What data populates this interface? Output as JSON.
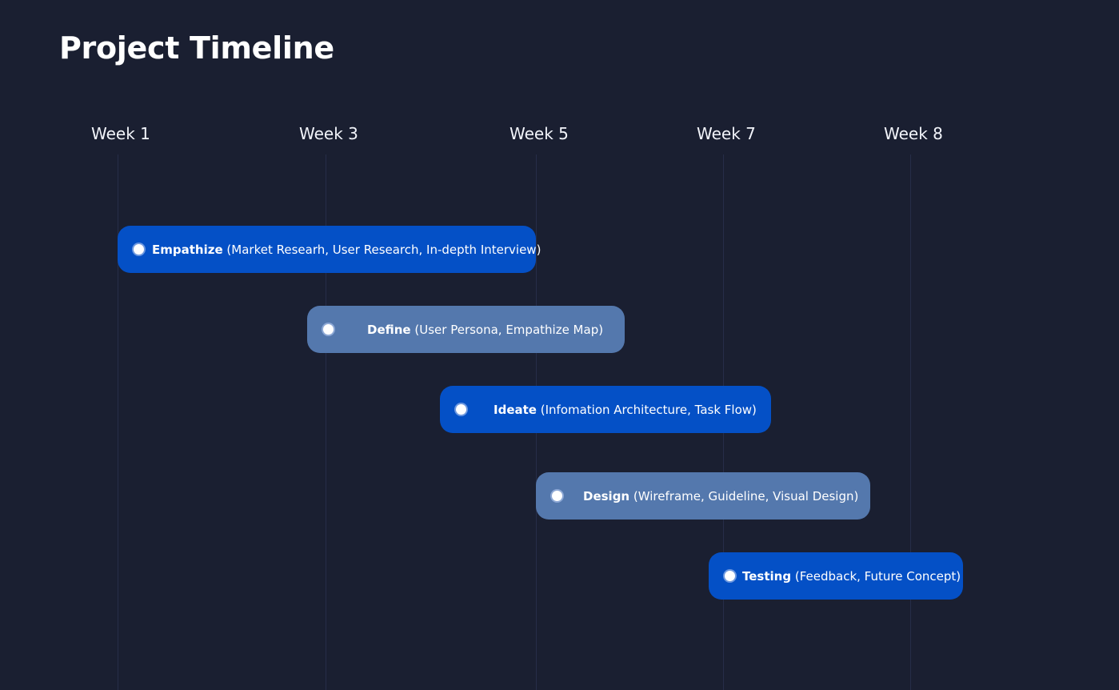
{
  "page": {
    "title": "Project Timeline"
  },
  "weeks": [
    "Week 1",
    "Week 3",
    "Week 5",
    "Week 7",
    "Week 8"
  ],
  "phases": [
    {
      "name": "Empathize",
      "detail": "(Market Researh, User Research, In-depth Interview)",
      "style": "primary",
      "color": "#0450c6"
    },
    {
      "name": "Define",
      "detail": "(User Persona, Empathize Map)",
      "style": "secondary",
      "color": "#5478ad"
    },
    {
      "name": "Ideate",
      "detail": "(Infomation Architecture, Task Flow)",
      "style": "primary",
      "color": "#0450c6"
    },
    {
      "name": "Design",
      "detail": "(Wireframe, Guideline, Visual Design)",
      "style": "secondary",
      "color": "#5478ad"
    },
    {
      "name": "Testing",
      "detail": "(Feedback, Future Concept)",
      "style": "primary",
      "color": "#0450c6"
    }
  ],
  "colors": {
    "background": "#1a1f31",
    "primary": "#0450c6",
    "secondary": "#5478ad"
  }
}
